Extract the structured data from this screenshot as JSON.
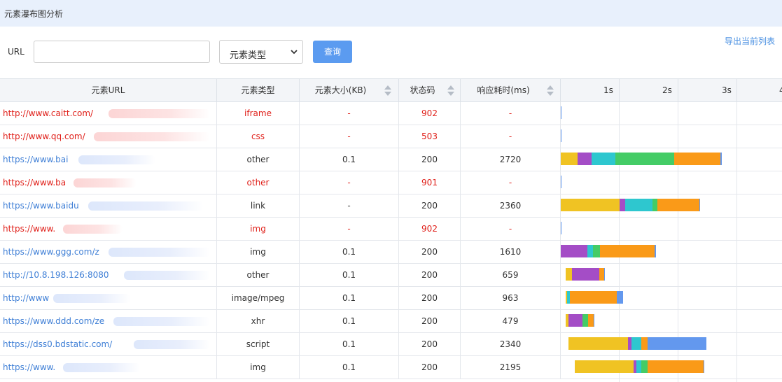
{
  "window": {
    "title": "元素瀑布图分析"
  },
  "toolbar": {
    "url_label": "URL",
    "url_value": "",
    "url_placeholder": "",
    "type_selected": "元素类型",
    "query_label": "查询",
    "export_label": "导出当前列表"
  },
  "table": {
    "headers": {
      "url": "元素URL",
      "type": "元素类型",
      "size": "元素大小(KB)",
      "status": "状态码",
      "time": "响应耗时(ms)"
    },
    "ticks": [
      "1s",
      "2s",
      "3s",
      "4"
    ],
    "rows": [
      {
        "url": "http://www.caitt.com/",
        "type": "iframe",
        "size": "-",
        "status": "902",
        "time": "-",
        "error": true
      },
      {
        "url": "http://www.qq.com/",
        "type": "css",
        "size": "-",
        "status": "503",
        "time": "-",
        "error": true
      },
      {
        "url": "https://www.bai",
        "type": "other",
        "size": "0.1",
        "status": "200",
        "time": "2720",
        "error": false
      },
      {
        "url": "https://www.ba",
        "type": "other",
        "size": "-",
        "status": "901",
        "time": "-",
        "error": true
      },
      {
        "url": "https://www.baidu",
        "type": "link",
        "size": "-",
        "status": "200",
        "time": "2360",
        "error": false
      },
      {
        "url": "https://www.",
        "type": "img",
        "size": "-",
        "status": "902",
        "time": "-",
        "error": true
      },
      {
        "url": "https://www.ggg.com/z",
        "type": "img",
        "size": "0.1",
        "status": "200",
        "time": "1610",
        "error": false
      },
      {
        "url": "http://10.8.198.126:8080",
        "type": "other",
        "size": "0.1",
        "status": "200",
        "time": "659",
        "error": false
      },
      {
        "url": "http://www",
        "type": "image/mpeg",
        "size": "0.1",
        "status": "200",
        "time": "963",
        "error": false
      },
      {
        "url": "https://www.ddd.com/ze",
        "type": "xhr",
        "size": "0.1",
        "status": "200",
        "time": "479",
        "error": false
      },
      {
        "url": "https://dss0.bdstatic.com/",
        "type": "script",
        "size": "0.1",
        "status": "200",
        "time": "2340",
        "error": false
      },
      {
        "url": "https://www.",
        "type": "img",
        "size": "0.1",
        "status": "200",
        "time": "2195",
        "error": false
      }
    ]
  },
  "waterfall": {
    "colors": {
      "yellow": "#f0c323",
      "purple": "#a44dc6",
      "teal": "#2ec7cf",
      "green": "#44cc66",
      "orange": "#fa9a18",
      "blue": "#6398ee"
    },
    "rows": [
      [
        [
          "blue",
          0,
          0.015
        ]
      ],
      [
        [
          "blue",
          0,
          0.015
        ]
      ],
      [
        [
          "yellow",
          0,
          0.29
        ],
        [
          "purple",
          0.29,
          0.52
        ],
        [
          "teal",
          0.52,
          0.93
        ],
        [
          "green",
          0.93,
          1.93
        ],
        [
          "orange",
          1.93,
          2.72
        ],
        [
          "blue",
          2.72,
          2.735
        ]
      ],
      [
        [
          "blue",
          0,
          0.015
        ]
      ],
      [
        [
          "yellow",
          0,
          1.0
        ],
        [
          "purple",
          1.0,
          1.09
        ],
        [
          "teal",
          1.09,
          1.56
        ],
        [
          "green",
          1.56,
          1.64
        ],
        [
          "orange",
          1.64,
          2.36
        ],
        [
          "blue",
          2.36,
          2.375
        ]
      ],
      [
        [
          "blue",
          0,
          0.015
        ]
      ],
      [
        [
          "purple",
          0,
          0.45
        ],
        [
          "teal",
          0.45,
          0.55
        ],
        [
          "green",
          0.55,
          0.67
        ],
        [
          "orange",
          0.67,
          1.6
        ],
        [
          "blue",
          1.6,
          1.615
        ]
      ],
      [
        [
          "yellow",
          0.08,
          0.19
        ],
        [
          "purple",
          0.19,
          0.65
        ],
        [
          "orange",
          0.65,
          0.74
        ],
        [
          "blue",
          0.74,
          0.755
        ]
      ],
      [
        [
          "yellow",
          0.08,
          0.11
        ],
        [
          "teal",
          0.11,
          0.16
        ],
        [
          "orange",
          0.16,
          0.95
        ],
        [
          "blue",
          0.95,
          1.06
        ]
      ],
      [
        [
          "yellow",
          0.08,
          0.13
        ],
        [
          "purple",
          0.13,
          0.37
        ],
        [
          "green",
          0.37,
          0.47
        ],
        [
          "orange",
          0.47,
          0.56
        ],
        [
          "blue",
          0.56,
          0.575
        ]
      ],
      [
        [
          "yellow",
          0.13,
          1.14
        ],
        [
          "purple",
          1.14,
          1.2
        ],
        [
          "teal",
          1.2,
          1.37
        ],
        [
          "orange",
          1.37,
          1.48
        ],
        [
          "blue",
          1.48,
          2.48
        ]
      ],
      [
        [
          "yellow",
          0.24,
          1.24
        ],
        [
          "purple",
          1.24,
          1.29
        ],
        [
          "teal",
          1.29,
          1.37
        ],
        [
          "green",
          1.37,
          1.48
        ],
        [
          "orange",
          1.48,
          2.43
        ],
        [
          "blue",
          2.43,
          2.445
        ]
      ]
    ]
  }
}
